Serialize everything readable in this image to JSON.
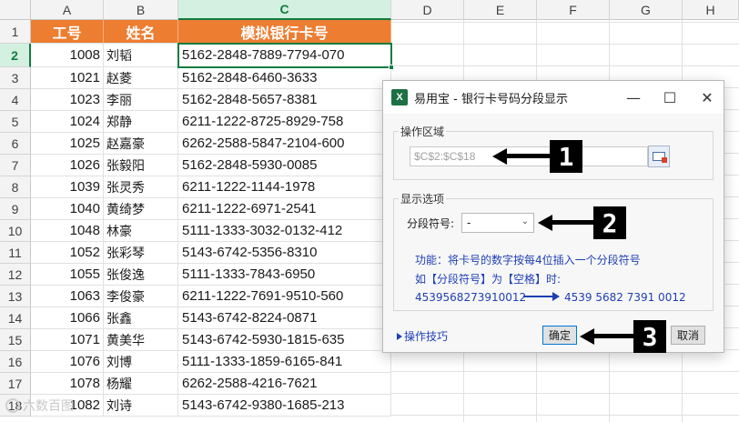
{
  "sheet": {
    "columns": [
      "A",
      "B",
      "C",
      "D",
      "E",
      "F",
      "G",
      "H"
    ],
    "rows": [
      "1",
      "2",
      "3",
      "4",
      "5",
      "6",
      "7",
      "8",
      "9",
      "10",
      "11",
      "12",
      "13",
      "14",
      "15",
      "16",
      "17",
      "18"
    ],
    "header": {
      "id": "工号",
      "name": "姓名",
      "card": "模拟银行卡号"
    },
    "records": [
      {
        "id": "1008",
        "name": "刘韬",
        "card": "5162-2848-7889-7794-070"
      },
      {
        "id": "1021",
        "name": "赵菱",
        "card": "5162-2848-6460-3633"
      },
      {
        "id": "1023",
        "name": "李丽",
        "card": "5162-2848-5657-8381"
      },
      {
        "id": "1024",
        "name": "郑静",
        "card": "6211-1222-8725-8929-758"
      },
      {
        "id": "1025",
        "name": "赵嘉豪",
        "card": "6262-2588-5847-2104-600"
      },
      {
        "id": "1026",
        "name": "张毅阳",
        "card": "5162-2848-5930-0085"
      },
      {
        "id": "1039",
        "name": "张灵秀",
        "card": "6211-1222-1144-1978"
      },
      {
        "id": "1040",
        "name": "黄绮梦",
        "card": "6211-1222-6971-2541"
      },
      {
        "id": "1048",
        "name": "林豪",
        "card": "5111-1333-3032-0132-412"
      },
      {
        "id": "1052",
        "name": "张彩琴",
        "card": "5143-6742-5356-8310"
      },
      {
        "id": "1055",
        "name": "张俊逸",
        "card": "5111-1333-7843-6950"
      },
      {
        "id": "1063",
        "name": "李俊豪",
        "card": "6211-1222-7691-9510-560"
      },
      {
        "id": "1066",
        "name": "张鑫",
        "card": "5143-6742-8224-0871"
      },
      {
        "id": "1071",
        "name": "黄美华",
        "card": "5143-6742-5930-1815-635"
      },
      {
        "id": "1076",
        "name": "刘博",
        "card": "5111-1333-1859-6165-841"
      },
      {
        "id": "1078",
        "name": "杨耀",
        "card": "6262-2588-4216-7621"
      },
      {
        "id": "1082",
        "name": "刘诗",
        "card": "5143-6742-9380-1685-213"
      }
    ],
    "selected_column": "C",
    "selected_row": "2"
  },
  "watermark": {
    "text": "六数百图"
  },
  "dialog": {
    "title": "易用宝 - 银行卡号码分段显示",
    "app_icon": "X",
    "minimize": "—",
    "maximize": "☐",
    "close": "✕",
    "range_group_label": "操作区域",
    "range_value": "$C$2:$C$18",
    "options_group_label": "显示选项",
    "separator_label": "分段符号:",
    "separator_value": "-",
    "info_line1": "功能：将卡号的数字按每4位插入一个分段符号",
    "info_line2": "如【分段符号】为【空格】时:",
    "example_before": "4539568273910012",
    "example_after": "4539 5682 7391 0012",
    "tips_label": "操作技巧",
    "ok_label": "确定",
    "cancel_label": "取消"
  },
  "annotations": {
    "badge1": "1",
    "badge2": "2",
    "badge3": "3"
  }
}
